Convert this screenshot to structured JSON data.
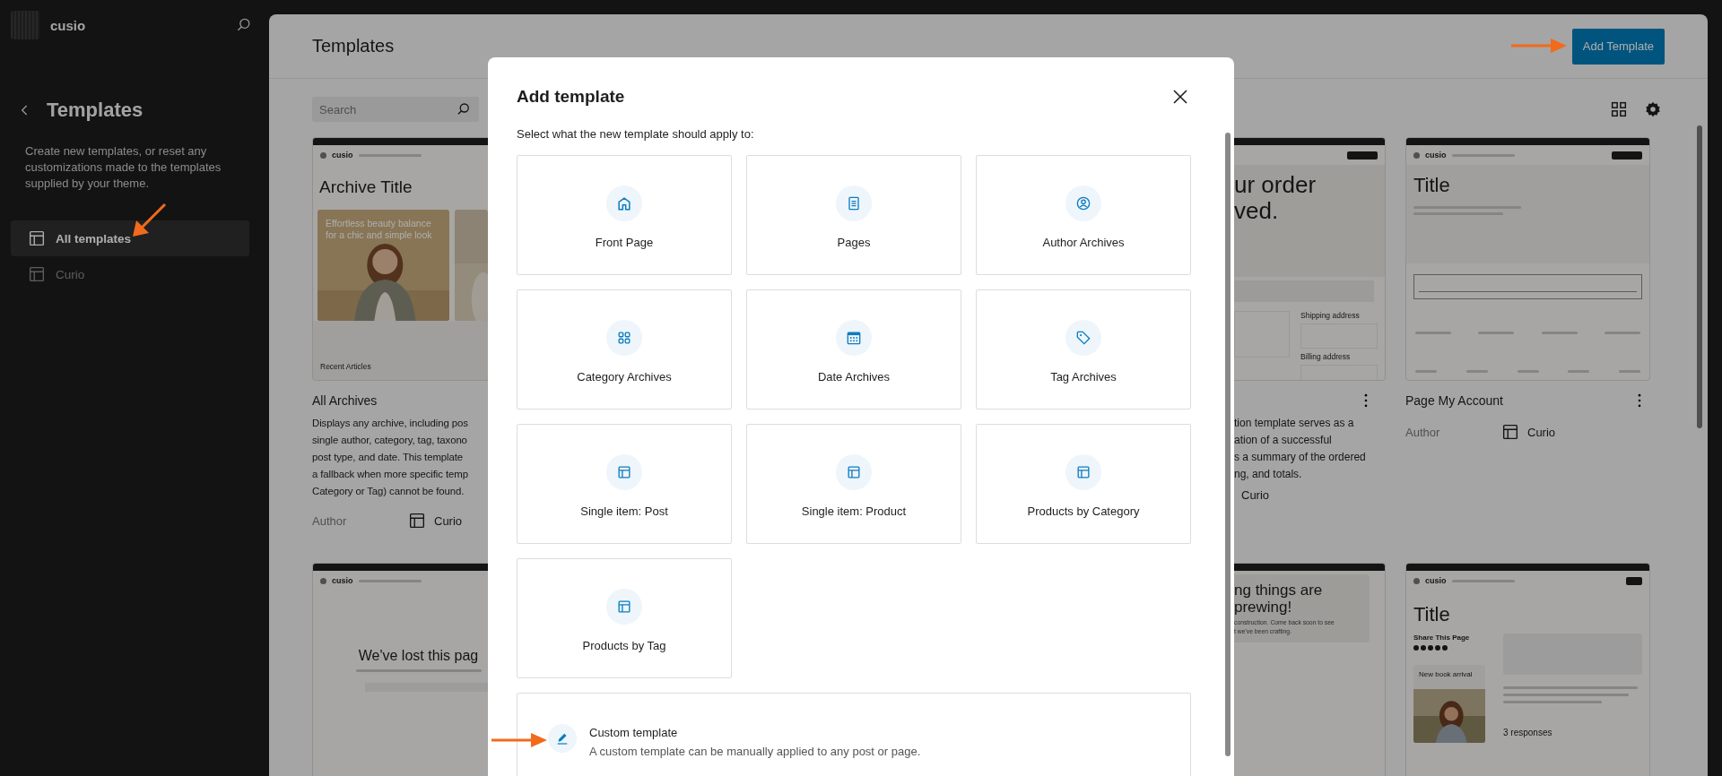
{
  "sidebar": {
    "site_name": "cusio",
    "title": "Templates",
    "description": "Create new templates, or reset any customizations made to the templates supplied by your theme.",
    "items": [
      {
        "label": "All templates",
        "selected": true
      },
      {
        "label": "Curio",
        "selected": false
      }
    ]
  },
  "header": {
    "title": "Templates",
    "add_button": "Add Template"
  },
  "search": {
    "placeholder": "Search"
  },
  "rows": [
    {
      "cards": [
        {
          "kind": "archive",
          "preview": {
            "site": "cusio",
            "heading": "Archive Title",
            "hero_text": "Effortless beauty balance\nfor a chic and simple look",
            "section": "Recent Articles"
          },
          "title": "All Archives",
          "description": "Displays any archive, including pos\nsingle author, category, tag, taxono\npost type, and date. This template\na fallback when more specific temp\nCategory or Tag) cannot be found.",
          "author": "Author",
          "theme": "Curio"
        },
        {
          "kind": "order",
          "preview": {
            "heading": "ur order\nved.",
            "labels": [
              "Shipping address",
              "Billing address"
            ]
          },
          "description": "tion template serves as a\nation of a successful\ns a summary of the ordered\nng, and totals.",
          "theme": "Curio"
        },
        {
          "kind": "account",
          "preview": {
            "site": "cusio",
            "heading": "Title"
          },
          "title": "Page My Account",
          "author": "Author",
          "theme": "Curio"
        }
      ]
    },
    {
      "cards": [
        {
          "kind": "notfound",
          "preview": {
            "site": "cusio",
            "heading": "We've lost this pag"
          }
        },
        {
          "kind": "coming_soon",
          "preview": {
            "heading": "ng things are\nprewing!",
            "subtext": "construction. Come back soon to see\nt we've been crafting."
          }
        },
        {
          "kind": "single",
          "preview": {
            "site": "cusio",
            "heading": "Title",
            "share": "Share This Page",
            "promo": "New book arrival",
            "responses": "3 responses"
          }
        }
      ]
    }
  ],
  "modal": {
    "title": "Add template",
    "subtitle": "Select what the new template should apply to:",
    "options": [
      {
        "label": "Front Page",
        "kind": "home"
      },
      {
        "label": "Pages",
        "kind": "page"
      },
      {
        "label": "Author Archives",
        "kind": "author"
      },
      {
        "label": "Category Archives",
        "kind": "category"
      },
      {
        "label": "Date Archives",
        "kind": "date"
      },
      {
        "label": "Tag Archives",
        "kind": "tag"
      },
      {
        "label": "Single item: Post",
        "kind": "layout"
      },
      {
        "label": "Single item: Product",
        "kind": "layout"
      },
      {
        "label": "Products by Category",
        "kind": "layout"
      },
      {
        "label": "Products by Tag",
        "kind": "layout"
      }
    ],
    "custom": {
      "title": "Custom template",
      "description": "A custom template can be manually applied to any post or page."
    }
  }
}
